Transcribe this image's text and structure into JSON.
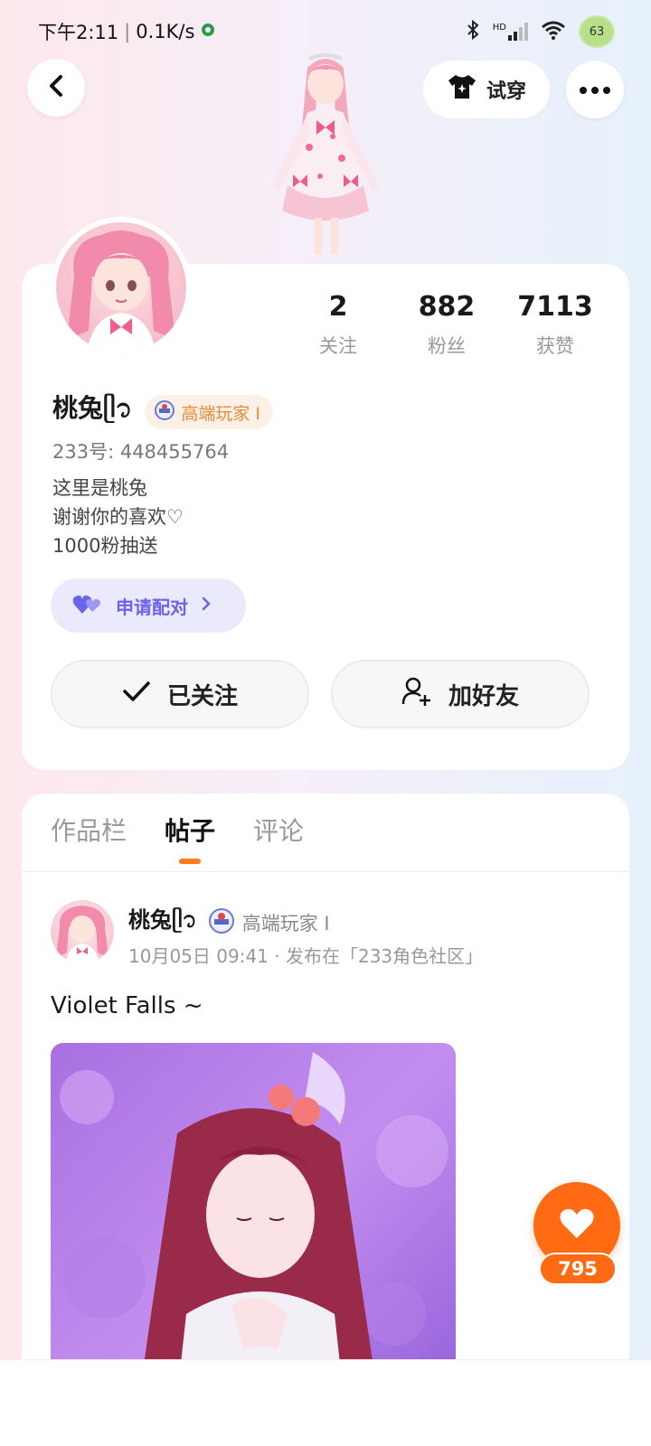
{
  "status_bar": {
    "time": "下午2:11",
    "speed": "0.1K/s",
    "network": "HD",
    "battery": "63"
  },
  "header": {
    "back_icon": "back-arrow-icon",
    "tryon_label": "试穿",
    "more_icon": "more-icon"
  },
  "profile": {
    "stats": [
      {
        "value": "2",
        "label": "关注"
      },
      {
        "value": "882",
        "label": "粉丝"
      },
      {
        "value": "7113",
        "label": "获赞"
      }
    ],
    "name": "桃兔ᥫ᭡",
    "level": "高端玩家 Ⅰ",
    "uid": "233号: 448455764",
    "bio": [
      "这里是桃兔",
      "谢谢你的喜欢♡",
      "1000粉抽送"
    ],
    "pair_label": "申请配对",
    "followed_label": "已关注",
    "add_friend_label": "加好友"
  },
  "tabs": [
    {
      "label": "作品栏",
      "active": false
    },
    {
      "label": "帖子",
      "active": true
    },
    {
      "label": "评论",
      "active": false
    }
  ],
  "post": {
    "author": "桃兔ᥫ᭡",
    "level": "高端玩家 Ⅰ",
    "meta": "10月05日 09:41 · 发布在「233角色社区」",
    "title": "Violet Falls ~"
  },
  "like": {
    "count": "795"
  },
  "colors": {
    "accent_orange": "#ff6a13",
    "pair_purple": "#6b64e8",
    "badge_orange": "#e28c38"
  }
}
